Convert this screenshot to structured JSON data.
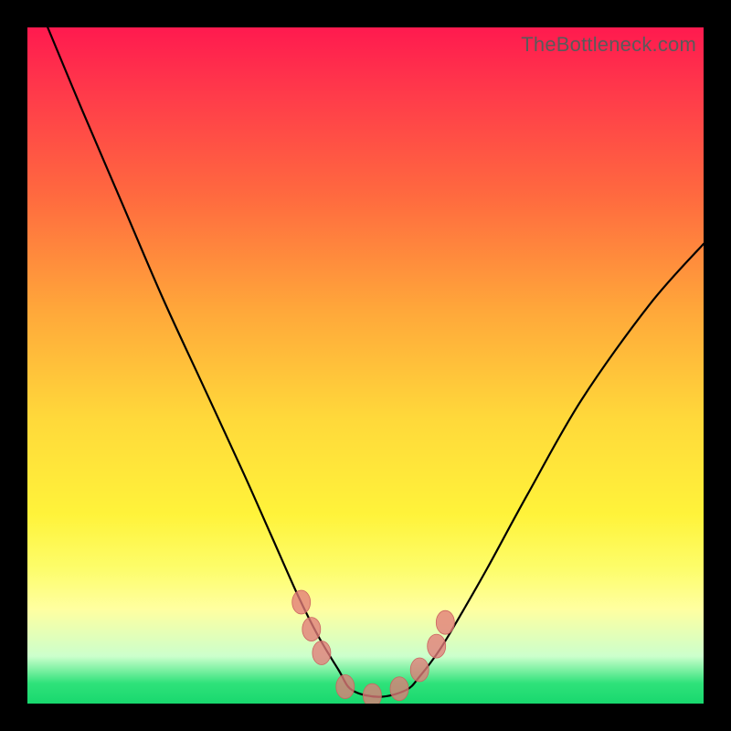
{
  "watermark": "TheBottleneck.com",
  "colors": {
    "frame": "#000000",
    "curve": "#000000",
    "marker": "#e27b78"
  },
  "chart_data": {
    "type": "line",
    "title": "",
    "xlabel": "",
    "ylabel": "",
    "xlim": [
      0,
      100
    ],
    "ylim": [
      0,
      100
    ],
    "grid": false,
    "legend": "none",
    "background_gradient": [
      {
        "pos": 0,
        "color": "#ff1a4f"
      },
      {
        "pos": 25,
        "color": "#ff6a3f"
      },
      {
        "pos": 58,
        "color": "#ffd93a"
      },
      {
        "pos": 86,
        "color": "#ffffa0"
      },
      {
        "pos": 97,
        "color": "#2fe27a"
      }
    ],
    "series": [
      {
        "name": "curve",
        "x": [
          3,
          8,
          14,
          20,
          26,
          32,
          36,
          40,
          43,
          46,
          48,
          52,
          56,
          58,
          61,
          64,
          68,
          74,
          82,
          92,
          100
        ],
        "y": [
          100,
          88,
          74,
          60,
          47,
          34,
          25,
          16,
          10,
          5,
          2,
          1,
          2,
          4,
          8,
          13,
          20,
          31,
          45,
          59,
          68
        ]
      }
    ],
    "markers": {
      "name": "highlight-points",
      "x": [
        40.5,
        42.0,
        43.5,
        47,
        51,
        55,
        58,
        60.5,
        61.8
      ],
      "y": [
        15,
        11,
        7.5,
        2.5,
        1.2,
        2.2,
        5,
        8.5,
        12
      ]
    }
  }
}
